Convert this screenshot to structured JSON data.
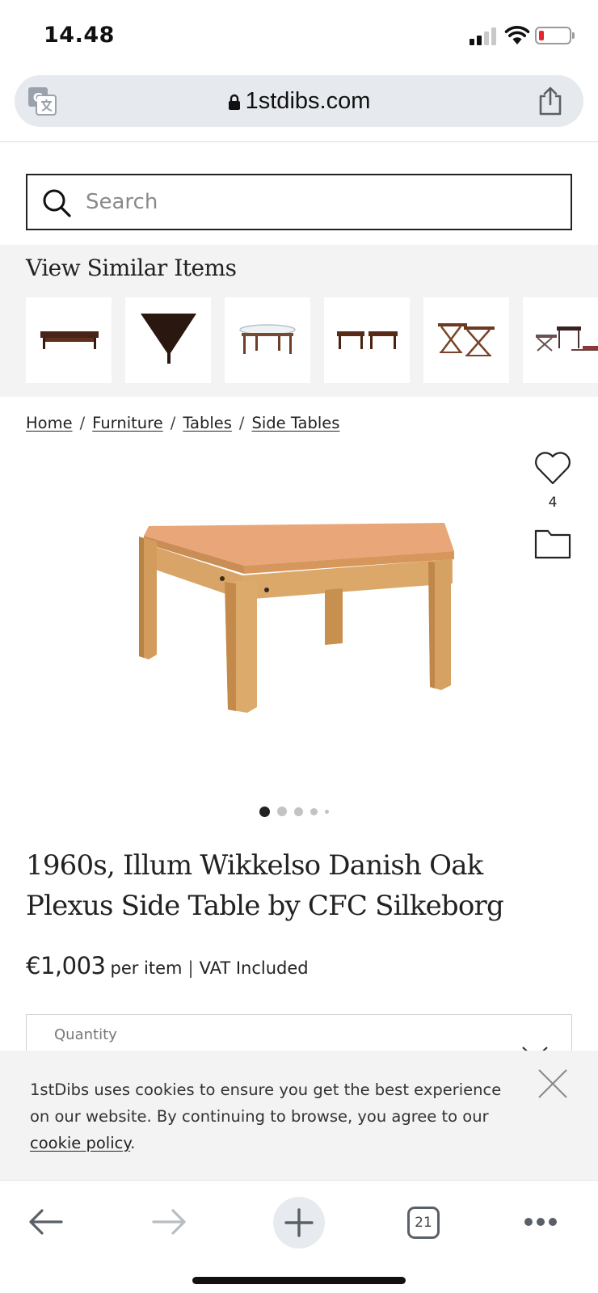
{
  "status_bar": {
    "time": "14.48",
    "signal_bars": 4,
    "signal_bars_active": 2,
    "battery_level": 0.15,
    "battery_color": "#e5262c"
  },
  "browser": {
    "url": "1stdibs.com",
    "icons": [
      "translate-icon",
      "lock-icon",
      "share-icon"
    ]
  },
  "search": {
    "placeholder": "Search",
    "value": ""
  },
  "similar": {
    "title": "View Similar Items",
    "items": [
      "coffee-table",
      "triangular-table",
      "glass-top-table",
      "pair-of-side-tables",
      "folding-stools",
      "nesting-tables"
    ]
  },
  "breadcrumb": [
    "Home",
    "Furniture",
    "Tables",
    "Side Tables"
  ],
  "breadcrumb_separator": "/",
  "product": {
    "favorites_count": "4",
    "image_total": 5,
    "image_active": 1,
    "title": "1960s, Illum Wikkelso Danish Oak Plexus Side Table by CFC Silkeborg",
    "price": "€1,003",
    "price_unit": "per item",
    "price_separator": "|",
    "vat_note": "VAT Included",
    "quantity_label": "Quantity"
  },
  "cookie": {
    "text_before_link": "1stDibs uses cookies to ensure you get the best experience on our website. By continuing to browse, you agree to our ",
    "link_text": "cookie policy",
    "text_after_link": "."
  },
  "toolbar": {
    "tab_count": "21",
    "icons": [
      "back-arrow-icon",
      "forward-arrow-icon",
      "plus-icon",
      "tabs-icon",
      "more-icon"
    ]
  },
  "colors": {
    "url_bar_bg": "#e6eaee",
    "section_bg": "#f3f3f3",
    "text": "#222222",
    "wood": "#d29d5e"
  }
}
